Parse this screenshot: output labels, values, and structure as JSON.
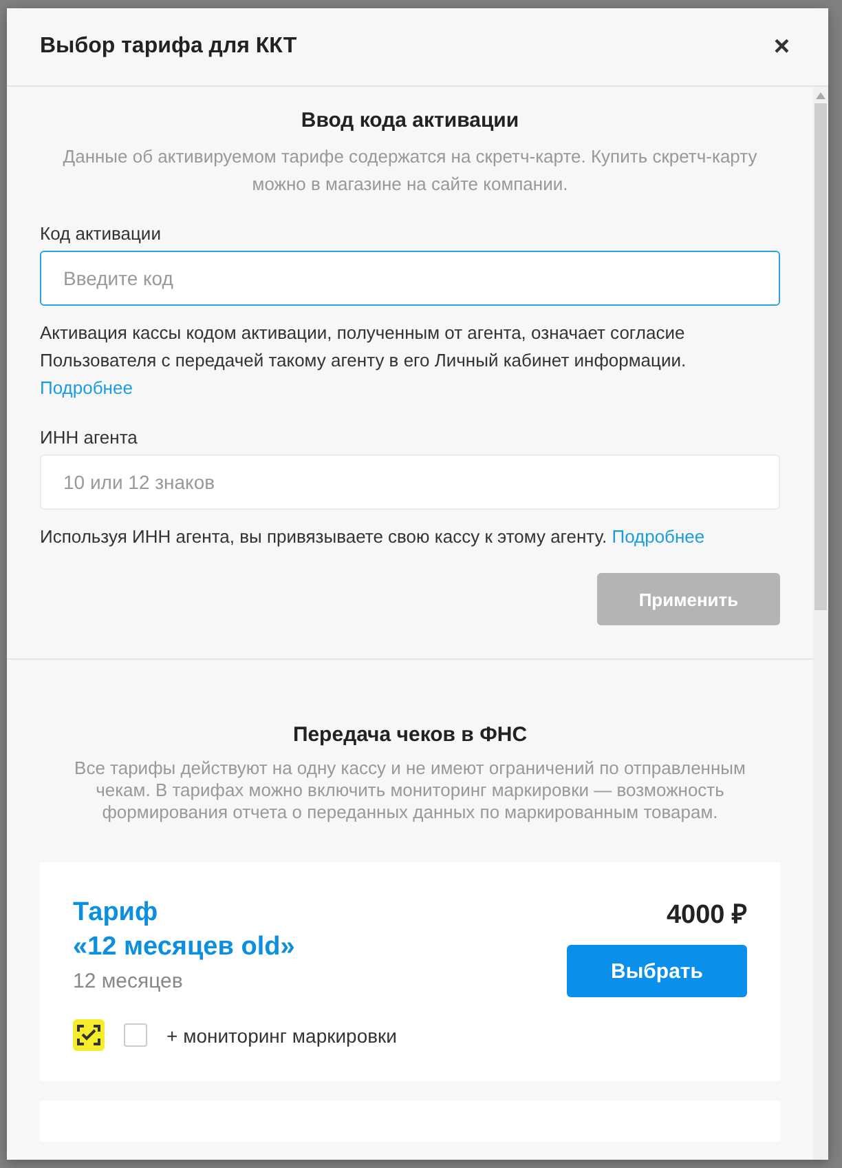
{
  "dialog": {
    "title": "Выбор тарифа для ККТ",
    "close": "×"
  },
  "activation": {
    "heading": "Ввод кода активации",
    "description": "Данные об активируемом тарифе содержатся на скретч-карте. Купить скретч-карту можно в магазине на сайте компании.",
    "code_label": "Код активации",
    "code_placeholder": "Введите код",
    "code_focused": true,
    "consent": "Активация кассы кодом активации, полученным от агента, означает согласие Пользователя с передачей такому агенту в его Личный кабинет информации.",
    "consent_link": "Подробнее",
    "inn_label": "ИНН агента",
    "inn_placeholder": "10 или 12 знаков",
    "inn_note": "Используя ИНН агента, вы привязываете свою кассу к этому агенту.",
    "inn_link": "Подробнее",
    "apply": {
      "label": "Применить",
      "disabled": true
    }
  },
  "fns": {
    "heading": "Передача чеков в ФНС",
    "description": "Все тарифы действуют на одну кассу и не имеют ограничений по отправленным чекам. В тарифах можно включить мониторинг маркировки — возможность формирования отчета о переданных данных по маркированным товарам."
  },
  "tariffs": [
    {
      "name_line1": "Тариф",
      "name_line2": "«12 месяцев old»",
      "period": "12 месяцев",
      "price": "4000 ₽",
      "select": "Выбрать",
      "option": {
        "label": "+ мониторинг маркировки",
        "checked": false
      }
    }
  ]
}
